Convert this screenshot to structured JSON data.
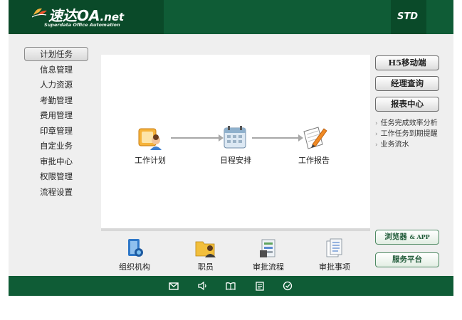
{
  "header": {
    "logo_main": "速达",
    "logo_oa": "OA",
    "logo_net": ".net",
    "logo_subtitle": "Superdata Office Automation",
    "edition": "STD"
  },
  "nav": {
    "items": [
      {
        "label": "计划任务",
        "active": true
      },
      {
        "label": "信息管理"
      },
      {
        "label": "人力资源"
      },
      {
        "label": "考勤管理"
      },
      {
        "label": "费用管理"
      },
      {
        "label": "印章管理"
      },
      {
        "label": "自定业务"
      },
      {
        "label": "审批中心"
      },
      {
        "label": "权限管理"
      },
      {
        "label": "流程设置"
      }
    ]
  },
  "flow": {
    "nodes": [
      {
        "label": "工作计划",
        "icon": "work-plan-icon"
      },
      {
        "label": "日程安排",
        "icon": "calendar-icon"
      },
      {
        "label": "工作报告",
        "icon": "report-icon"
      }
    ]
  },
  "shortcuts": {
    "items": [
      {
        "label": "组织机构",
        "icon": "organization-icon"
      },
      {
        "label": "职员",
        "icon": "staff-folder-icon"
      },
      {
        "label": "审批流程",
        "icon": "approval-flow-icon"
      },
      {
        "label": "审批事项",
        "icon": "approval-items-icon"
      }
    ]
  },
  "right": {
    "buttons": [
      "H5移动端",
      "经理查询",
      "报表中心"
    ],
    "links": [
      "任务完成效率分析",
      "工作任务到期提醒",
      "业务流水"
    ],
    "browser_btn_main": "浏览器",
    "browser_btn_small": "& APP",
    "service_btn": "服务平台"
  },
  "footer": {
    "icons": [
      "mail-icon",
      "speaker-icon",
      "book-icon",
      "document-icon",
      "check-circle-icon"
    ]
  },
  "colors": {
    "header_green": "#0f5c36",
    "header_dark_green": "#0a4a29",
    "panel_bg": "#ffffff",
    "page_bg": "#efefef"
  }
}
